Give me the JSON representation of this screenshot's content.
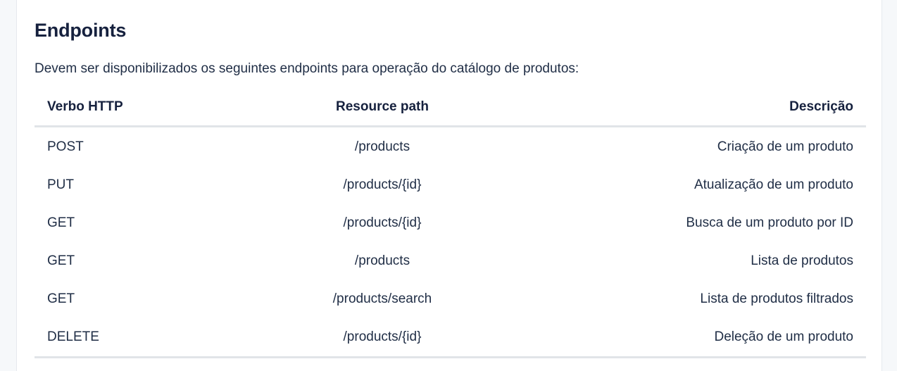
{
  "section": {
    "title": "Endpoints",
    "intro": "Devem ser disponibilizados os seguintes endpoints para operação do catálogo de produtos:"
  },
  "table": {
    "headers": {
      "verb": "Verbo HTTP",
      "path": "Resource path",
      "description": "Descrição"
    },
    "rows": [
      {
        "verb": "POST",
        "path": "/products",
        "description": "Criação de um produto"
      },
      {
        "verb": "PUT",
        "path": "/products/{id}",
        "description": "Atualização de um produto"
      },
      {
        "verb": "GET",
        "path": "/products/{id}",
        "description": "Busca de um produto por ID"
      },
      {
        "verb": "GET",
        "path": "/products",
        "description": "Lista de produtos"
      },
      {
        "verb": "GET",
        "path": "/products/search",
        "description": "Lista de produtos filtrados"
      },
      {
        "verb": "DELETE",
        "path": "/products/{id}",
        "description": "Deleção de um produto"
      }
    ]
  }
}
